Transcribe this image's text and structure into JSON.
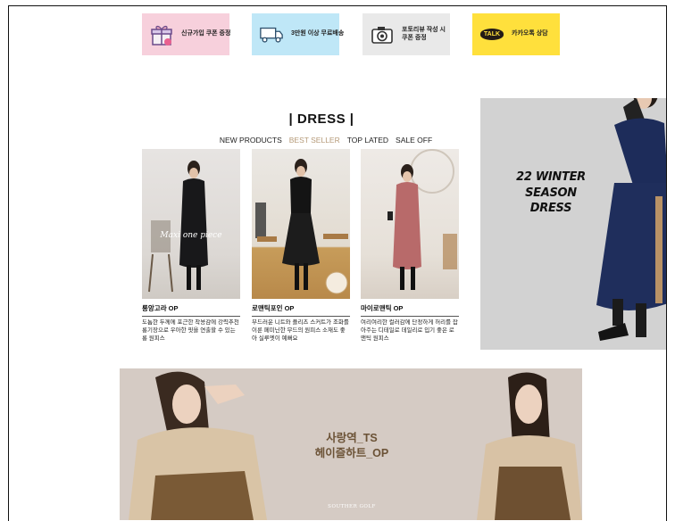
{
  "promos": [
    {
      "icon": "gift-icon",
      "text": "신규가입 쿠폰 증정",
      "bg": "#f7d0dc"
    },
    {
      "icon": "truck-icon",
      "text": "3만원 이상 무료배송",
      "bg": "#bfe7f7"
    },
    {
      "icon": "camera-icon",
      "text_line1": "포토리뷰 작성 시",
      "text_line2": "쿠폰 증정",
      "bg": "#e9e9e9"
    },
    {
      "icon": "kakao-talk-icon",
      "badge": "TALK",
      "text": "카카오톡 상담",
      "bg": "#ffe03c"
    }
  ],
  "section": {
    "title": "| DRESS |",
    "tabs": [
      "NEW PRODUCTS",
      "BEST SELLER",
      "TOP LATED",
      "SALE OFF"
    ],
    "active_tab": "BEST SELLER",
    "active_color": "#b59a78"
  },
  "products": [
    {
      "name": "롱앙고라 OP",
      "overlay": "Maxi one piece",
      "desc": "도톰한 두께에 포근한 착용감에 강력추천 롱기장으로 우아한 핏을 연출할 수 있는 롱 원피스"
    },
    {
      "name": "로맨틱포인 OP",
      "desc": "부드러운 니트와 플리츠 스커트가 조화를 이룬 페미닌한 무드의 원피스 소재도 좋아 실루엣이 예뻐요"
    },
    {
      "name": "마이로맨틱 OP",
      "desc": "여리여리한 컬러감에 단정하게 허리를 잡아주는 디테일로 데일리로 입기 좋은 로맨틱 원피스"
    }
  ],
  "side_banner": {
    "line1": "22 WINTER SEASON",
    "line2": "DRESS",
    "bg": "#d2d2d2"
  },
  "bottom_banner": {
    "line1": "사랑역_TS",
    "line2": "헤이즐하트_OP",
    "small": "SOUTHER GOLF",
    "bg": "#d5cbc4"
  }
}
